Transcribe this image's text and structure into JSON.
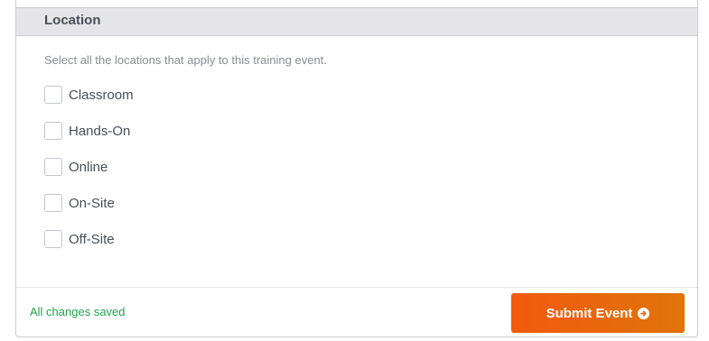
{
  "section": {
    "title": "Location",
    "help_text": "Select all the locations that apply to this training event."
  },
  "options": [
    {
      "label": "Classroom",
      "checked": false
    },
    {
      "label": "Hands-On",
      "checked": false
    },
    {
      "label": "Online",
      "checked": false
    },
    {
      "label": "On-Site",
      "checked": false
    },
    {
      "label": "Off-Site",
      "checked": false
    }
  ],
  "footer": {
    "status": "All changes saved",
    "submit_label": "Submit Event",
    "submit_icon": "arrow-right-circle-icon"
  },
  "colors": {
    "accent_start": "#f25a0e",
    "accent_end": "#e0740a",
    "status_green": "#22a34a",
    "header_bg": "#e5e5e8"
  }
}
